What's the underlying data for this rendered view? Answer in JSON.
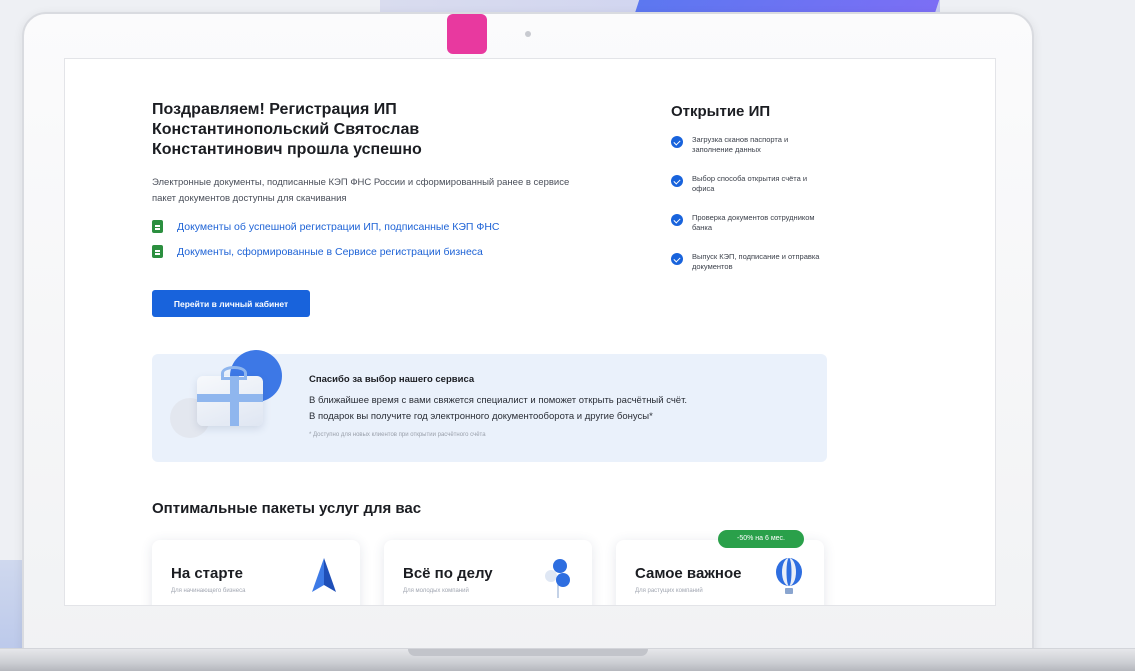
{
  "hero": {
    "title": "Поздравляем! Регистрация ИП Константинопольский Святослав Константинович прошла успешно",
    "subtitle": "Электронные документы, подписанные КЭП ФНС России и сформированный ранее в сервисе пакет документов доступны для скачивания"
  },
  "documents": [
    {
      "label": "Документы об успешной регистрации ИП, подписанные КЭП ФНС",
      "icon": "document-icon"
    },
    {
      "label": "Документы, сформированные в Сервисе регистрации бизнеса",
      "icon": "document-icon"
    }
  ],
  "cta": {
    "label": "Перейти в личный кабинет"
  },
  "steps": {
    "title": "Открытие ИП",
    "items": [
      "Загрузка сканов паспорта и заполнение данных",
      "Выбор способа открытия счёта и офиса",
      "Проверка документов сотрудником банка",
      "Выпуск КЭП, подписание и отправка документов"
    ]
  },
  "thanks": {
    "title": "Спасибо за выбор нашего сервиса",
    "line1": "В ближайшее время с вами свяжется специалист и поможет открыть расчётный счёт.",
    "line2": "В подарок вы получите год электронного документооборота и другие бонусы*",
    "note": "* Доступно для новых клиентов при открытии расчётного счёта"
  },
  "packages": {
    "title": "Оптимальные пакеты услуг для вас",
    "badge": "-50% на 6 мес.",
    "plans": [
      {
        "name": "На старте",
        "subtitle": "Для начинающего бизнеса",
        "icon": "paper-plane-icon"
      },
      {
        "name": "Всё по делу",
        "subtitle": "Для молодых компаний",
        "icon": "balloons-icon"
      },
      {
        "name": "Самое важное",
        "subtitle": "Для растущих компаний",
        "icon": "hot-air-balloon-icon"
      }
    ]
  },
  "colors": {
    "accent": "#1863dc",
    "badge": "#2aa04a",
    "brand_pink": "#e8399f"
  }
}
